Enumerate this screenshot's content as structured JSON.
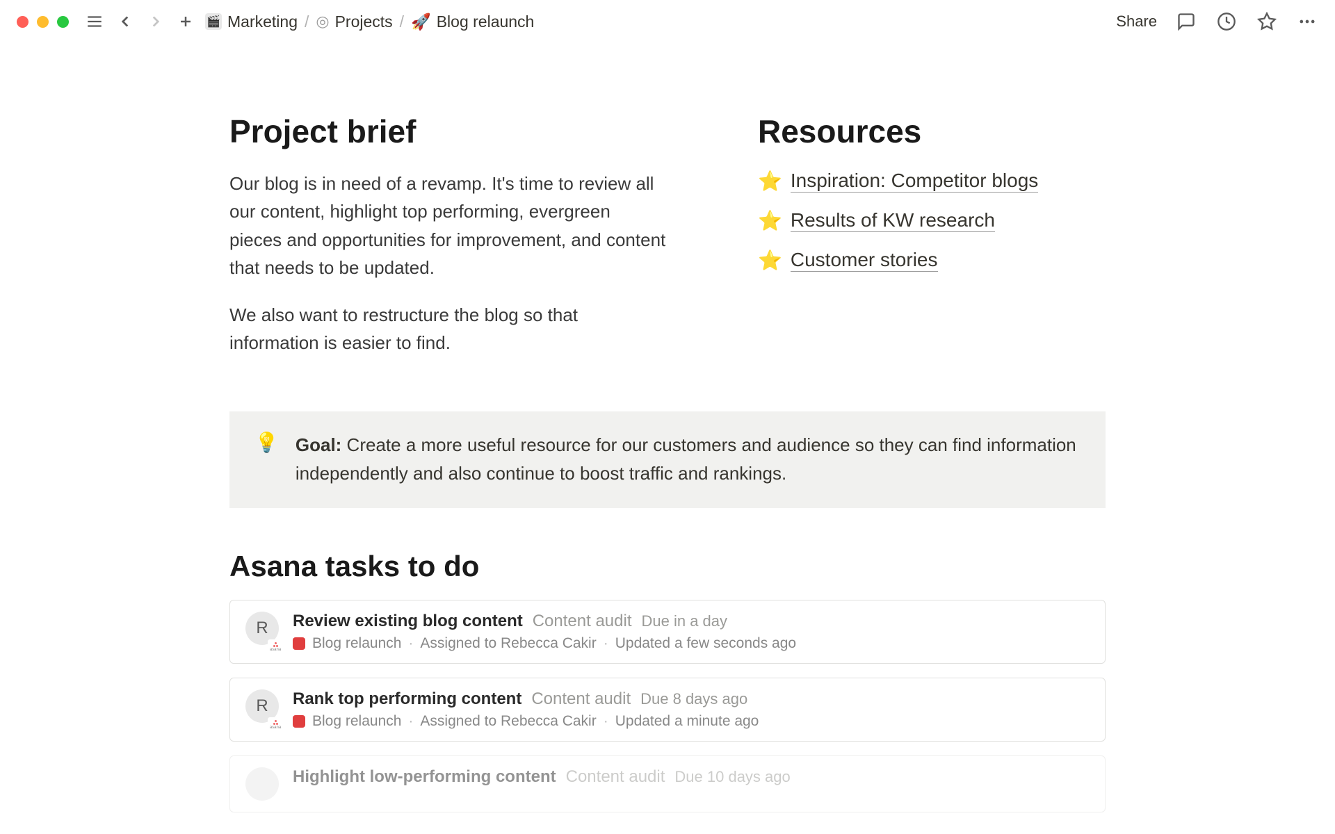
{
  "breadcrumb": {
    "level1_icon": "🎬",
    "level1": "Marketing",
    "level2_icon": "◎",
    "level2": "Projects",
    "level3_icon": "🚀",
    "level3": "Blog relaunch"
  },
  "topbar": {
    "share": "Share"
  },
  "brief": {
    "heading": "Project brief",
    "para1": "Our blog is in need of a revamp. It's time to review all our content, highlight top performing, evergreen pieces and opportunities for improvement, and content that needs to be updated.",
    "para2": "We also want to restructure the blog so that information is easier to find."
  },
  "resources": {
    "heading": "Resources",
    "items": [
      {
        "icon": "⭐",
        "label": "Inspiration: Competitor blogs"
      },
      {
        "icon": "⭐",
        "label": "Results of KW research"
      },
      {
        "icon": "⭐",
        "label": "Customer stories"
      }
    ]
  },
  "callout": {
    "icon": "💡",
    "bold": "Goal:",
    "text": " Create a more useful resource for our customers and audience so they can find information independently and also continue to boost traffic and rankings."
  },
  "tasks": {
    "heading": "Asana tasks to do",
    "items": [
      {
        "avatar": "R",
        "title": "Review existing blog content",
        "category": "Content audit",
        "due": "Due in a day",
        "project": "Blog relaunch",
        "assigned": "Assigned to Rebecca Cakir",
        "updated": "Updated a few seconds ago"
      },
      {
        "avatar": "R",
        "title": "Rank top performing content",
        "category": "Content audit",
        "due": "Due 8 days ago",
        "project": "Blog relaunch",
        "assigned": "Assigned to Rebecca Cakir",
        "updated": "Updated a minute ago"
      },
      {
        "avatar": "",
        "title": "Highlight low-performing content",
        "category": "Content audit",
        "due": "Due 10 days ago",
        "project": "",
        "assigned": "",
        "updated": ""
      }
    ]
  }
}
